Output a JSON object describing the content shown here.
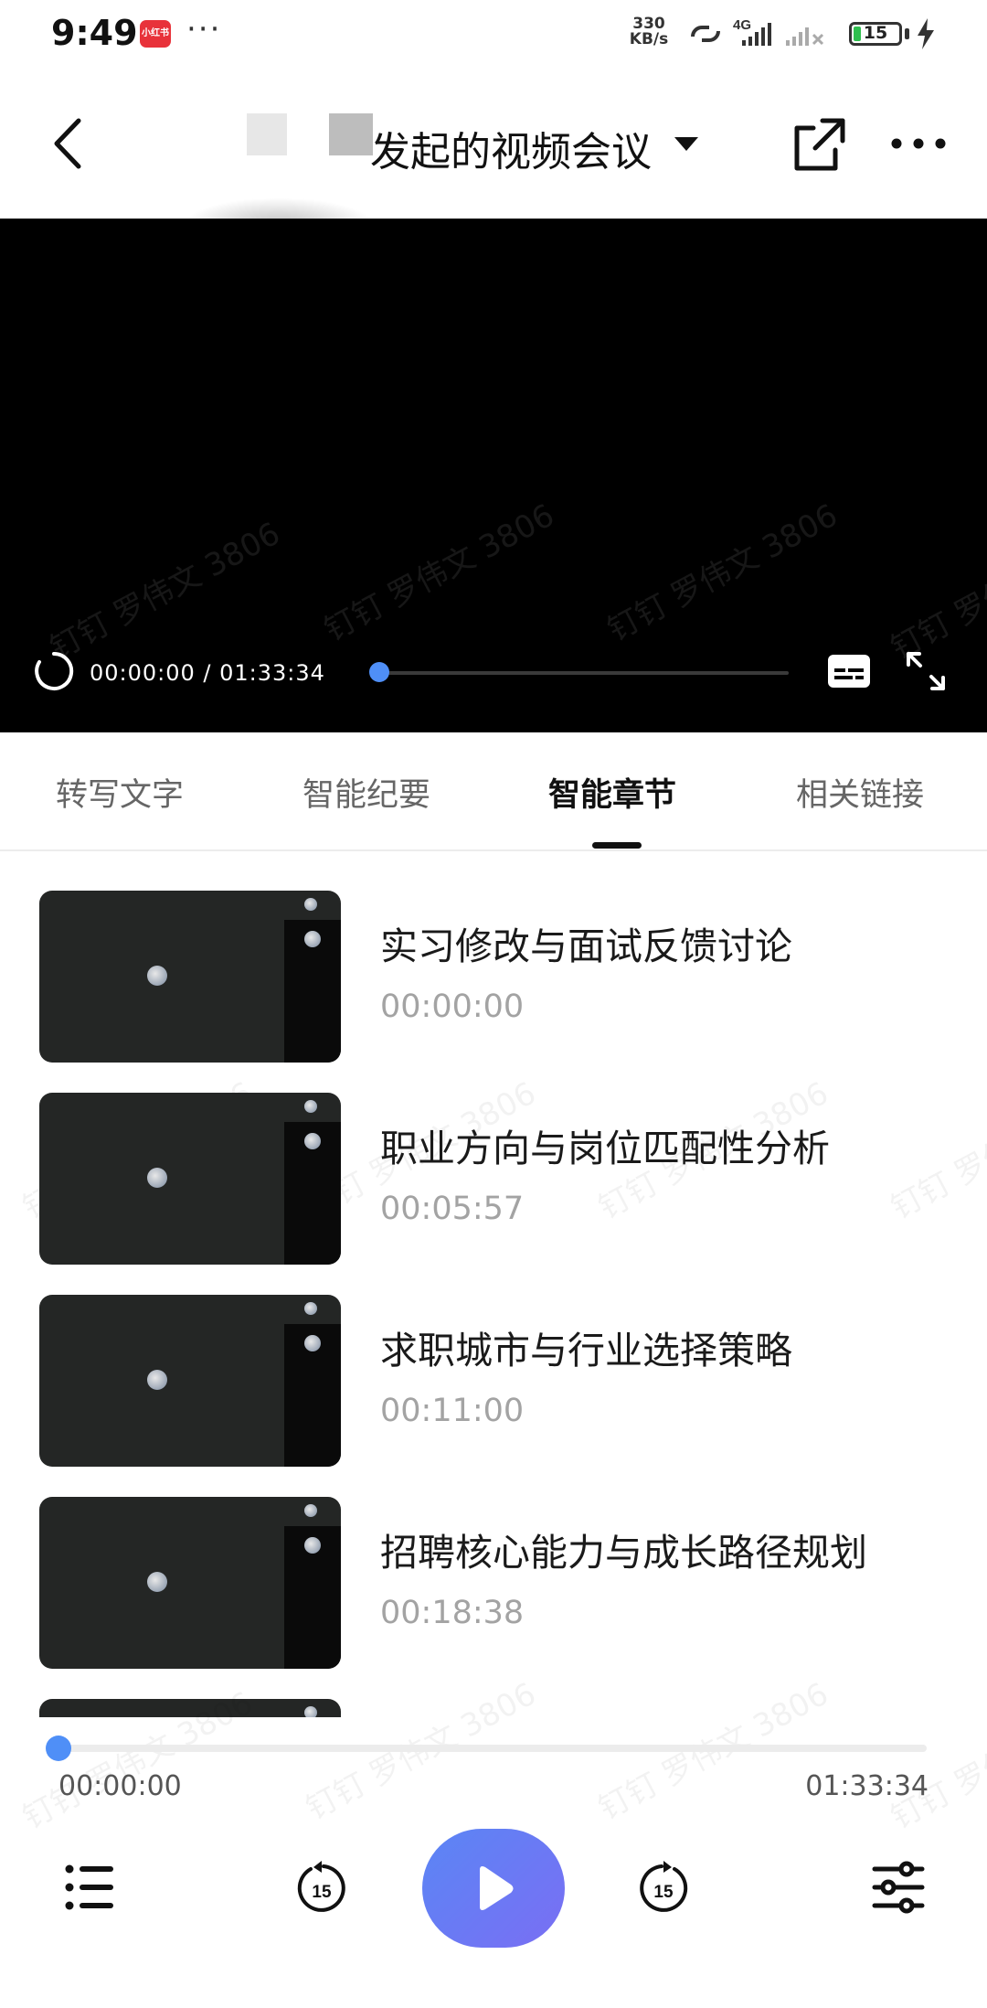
{
  "status_bar": {
    "time": "9:49",
    "app_badge": "小红书",
    "more_indicator": "···",
    "net_speed_value": "330",
    "net_speed_unit": "KB/s",
    "network_type": "4G",
    "battery_level": "15",
    "battery_fraction": 0.15,
    "icons": [
      "hotspot-link-icon",
      "signal-4g-icon",
      "signal-no-service-icon",
      "charging-icon"
    ]
  },
  "header": {
    "title": "发起的视频会议",
    "icons": [
      "back-icon",
      "dropdown-caret-icon",
      "share-icon",
      "more-icon"
    ]
  },
  "video": {
    "time_display": "00:00:00 / 01:33:34",
    "watermark": "钉钉 罗伟文 3806",
    "progress_fraction": 0.0,
    "icons": [
      "loading-spinner-icon",
      "subtitle-icon",
      "fullscreen-icon"
    ]
  },
  "tabs": [
    {
      "label": "转写文字",
      "active": false
    },
    {
      "label": "智能纪要",
      "active": false
    },
    {
      "label": "智能章节",
      "active": true
    },
    {
      "label": "相关链接",
      "active": false
    }
  ],
  "chapters": [
    {
      "title": "实习修改与面试反馈讨论",
      "time": "00:00:00"
    },
    {
      "title": "职业方向与岗位匹配性分析",
      "time": "00:05:57"
    },
    {
      "title": "求职城市与行业选择策略",
      "time": "00:11:00"
    },
    {
      "title": "招聘核心能力与成长路径规划",
      "time": "00:18:38"
    }
  ],
  "player": {
    "current_time": "00:00:00",
    "total_time": "01:33:34",
    "progress_fraction": 0.0,
    "rewind_seconds": "15",
    "forward_seconds": "15",
    "accent_color": "#4f8ff7",
    "icons": [
      "playlist-icon",
      "rewind-15-icon",
      "play-icon",
      "forward-15-icon",
      "settings-sliders-icon"
    ]
  }
}
